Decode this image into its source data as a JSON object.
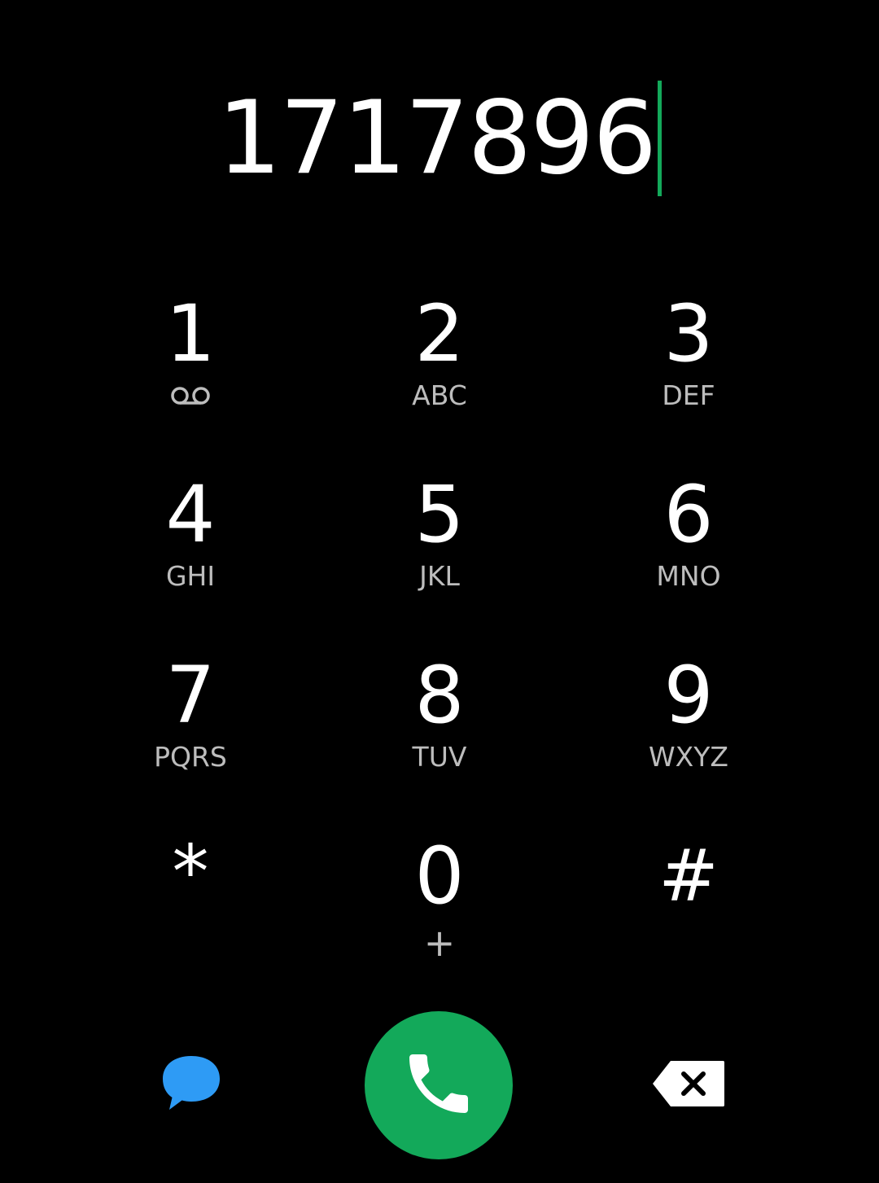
{
  "display": {
    "number": "1717896"
  },
  "keypad": {
    "keys": [
      {
        "digit": "1",
        "letters": "",
        "icon": "voicemail-icon"
      },
      {
        "digit": "2",
        "letters": "ABC"
      },
      {
        "digit": "3",
        "letters": "DEF"
      },
      {
        "digit": "4",
        "letters": "GHI"
      },
      {
        "digit": "5",
        "letters": "JKL"
      },
      {
        "digit": "6",
        "letters": "MNO"
      },
      {
        "digit": "7",
        "letters": "PQRS"
      },
      {
        "digit": "8",
        "letters": "TUV"
      },
      {
        "digit": "9",
        "letters": "WXYZ"
      },
      {
        "digit": "*",
        "letters": ""
      },
      {
        "digit": "0",
        "letters": "+"
      },
      {
        "digit": "#",
        "letters": ""
      }
    ]
  },
  "bottom": {
    "message_icon": "message-bubble-icon",
    "call_icon": "phone-handset-icon",
    "backspace_icon": "backspace-icon"
  },
  "colors": {
    "background": "#000000",
    "caret": "#13a95a",
    "call_button": "#13a95a",
    "message_icon": "#2e9bf5",
    "letters": "#bdbdbd",
    "digits": "#ffffff"
  }
}
